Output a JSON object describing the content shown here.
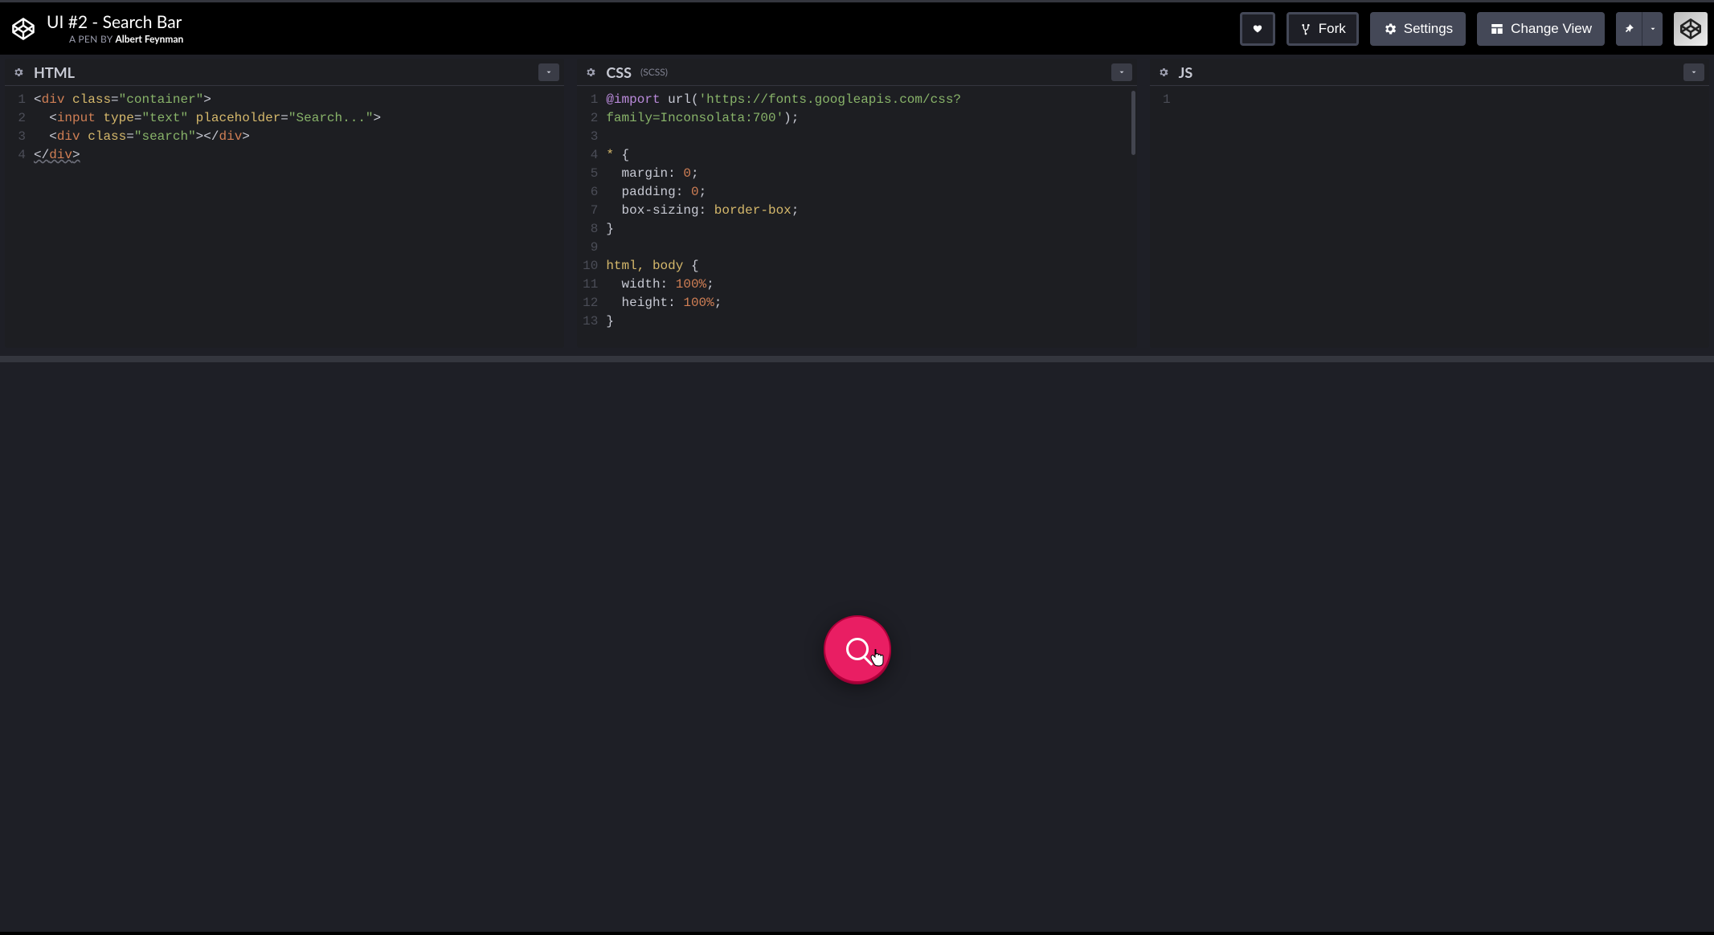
{
  "header": {
    "title": "UI #2 - Search Bar",
    "byline_prefix": "A PEN BY ",
    "author": "Albert Feynman",
    "buttons": {
      "fork": "Fork",
      "settings": "Settings",
      "change_view": "Change View"
    }
  },
  "panes": {
    "html": {
      "title": "HTML"
    },
    "css": {
      "title": "CSS",
      "sub": "(SCSS)"
    },
    "js": {
      "title": "JS"
    }
  },
  "code": {
    "html": {
      "line_nums": [
        "1",
        "2",
        "3",
        "4"
      ],
      "l1": {
        "open": "<",
        "tag": "div",
        "sp": " ",
        "attr": "class",
        "eq": "=",
        "val": "\"container\"",
        "close": ">"
      },
      "l2": {
        "indent": "  ",
        "open": "<",
        "tag": "input",
        "sp": " ",
        "a1": "type",
        "eq": "=",
        "v1": "\"text\"",
        "sp2": " ",
        "a2": "placeholder",
        "v2": "\"Search...\"",
        "close": ">"
      },
      "l3": {
        "indent": "  ",
        "open": "<",
        "tag": "div",
        "sp": " ",
        "attr": "class",
        "eq": "=",
        "val": "\"search\"",
        "close": ">",
        "open2": "</",
        "tag2": "div",
        "close2": ">"
      },
      "l4": {
        "open": "</",
        "tag": "div",
        "close": ">"
      }
    },
    "css": {
      "line_nums": [
        "1",
        "2",
        "3",
        "4",
        "5",
        "6",
        "7",
        "8",
        "9",
        "10",
        "11",
        "12",
        "13"
      ],
      "l1a": "@import",
      "l1b": " url(",
      "l1c": "'https://fonts.googleapis.com/css?",
      "l2c": "family=Inconsolata:700'",
      "l2d": ");",
      "l3": "",
      "l4sel": "* ",
      "l4brace": "{",
      "l5p": "  margin",
      "l5c": ": ",
      "l5v": "0",
      "l5s": ";",
      "l6p": "  padding",
      "l6c": ": ",
      "l6v": "0",
      "l6s": ";",
      "l7p": "  box-sizing",
      "l7c": ": ",
      "l7v": "border-box",
      "l7s": ";",
      "l8": "}",
      "l9": "",
      "l10sel": "html, body ",
      "l10brace": "{",
      "l11p": "  width",
      "l11c": ": ",
      "l11v": "100%",
      "l11s": ";",
      "l12p": "  height",
      "l12c": ": ",
      "l12v": "100%",
      "l12s": ";",
      "l13": "}"
    },
    "js": {
      "line_nums": [
        "1"
      ]
    }
  }
}
